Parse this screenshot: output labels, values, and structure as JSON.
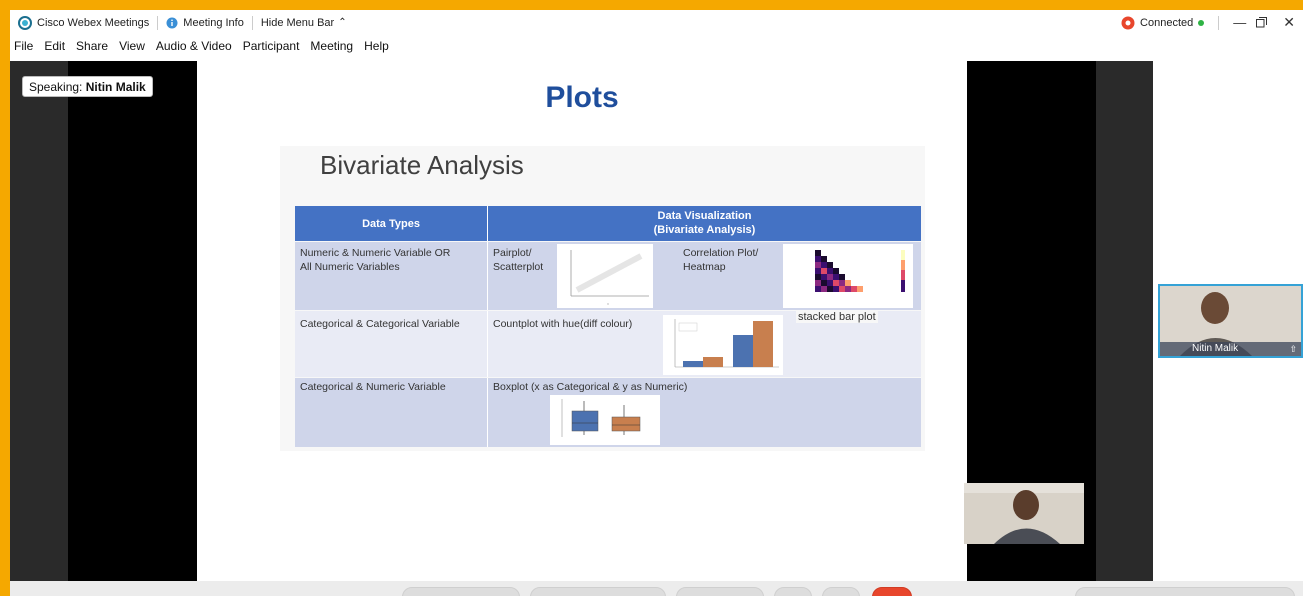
{
  "titlebar": {
    "app_name": "Cisco Webex Meetings",
    "meeting_info": "Meeting Info",
    "hide_menu": "Hide Menu Bar",
    "status": "Connected"
  },
  "menu": [
    "File",
    "Edit",
    "Share",
    "View",
    "Audio & Video",
    "Participant",
    "Meeting",
    "Help"
  ],
  "speaking": {
    "label": "Speaking:",
    "name": "Nitin Malik"
  },
  "slide": {
    "title": "Plots",
    "subtitle": "Bivariate Analysis",
    "table": {
      "header_col1": "Data Types",
      "header_col2_line1": "Data Visualization",
      "header_col2_line2": "(Bivariate Analysis)",
      "rows": [
        {
          "type_line1": "Numeric & Numeric Variable  OR",
          "type_line2": "All Numeric Variables",
          "viz_a_line1": "Pairplot/",
          "viz_a_line2": "Scatterplot",
          "viz_b_line1": "Correlation Plot/",
          "viz_b_line2": "Heatmap"
        },
        {
          "type_line1": "Categorical & Categorical Variable",
          "viz_a_line1": "Countplot with hue(diff colour)",
          "viz_b_line1": "stacked bar plot"
        },
        {
          "type_line1": "Categorical & Numeric Variable",
          "viz_a_line1": "Boxplot (x as Categorical & y as Numeric)"
        }
      ]
    }
  },
  "participant_tile": {
    "name": "Nitin Malik"
  },
  "colors": {
    "frame": "#f5a800",
    "table_header": "#4472c4",
    "row_band": "#cfd5ea",
    "accent": "#1f4e9c"
  }
}
